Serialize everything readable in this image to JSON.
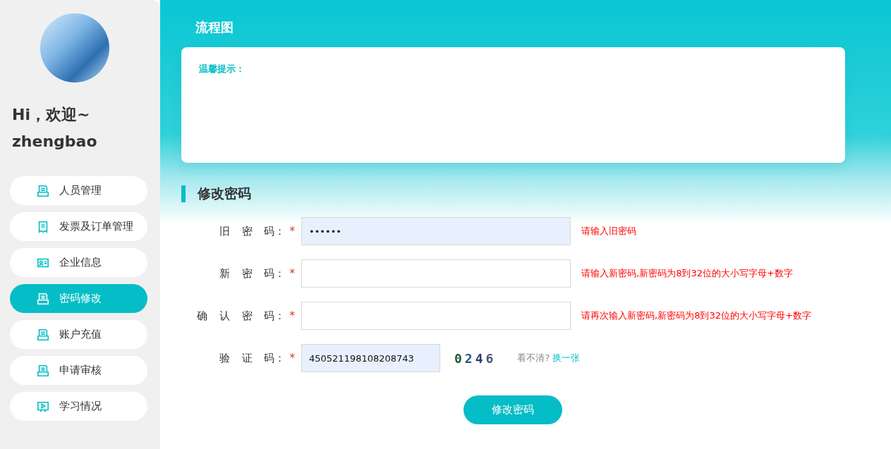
{
  "sidebar": {
    "greeting": "Hi，欢迎~",
    "username": "zhengbao",
    "items": [
      {
        "label": "人员管理",
        "selected": false
      },
      {
        "label": "发票及订单管理",
        "selected": false
      },
      {
        "label": "企业信息",
        "selected": false
      },
      {
        "label": "密码修改",
        "selected": true
      },
      {
        "label": "账户充值",
        "selected": false
      },
      {
        "label": "申请审核",
        "selected": false
      },
      {
        "label": "学习情况",
        "selected": false
      }
    ]
  },
  "page_title": "流程图",
  "notice": {
    "title": "温馨提示："
  },
  "section_title": "修改密码",
  "form": {
    "fields": [
      {
        "label": "旧 密 码：",
        "required_mark": "*",
        "value": "••••••",
        "hint": "请输入旧密码",
        "filled": true
      },
      {
        "label": "新 密 码：",
        "required_mark": "*",
        "hint": "请输入新密码,新密码为8到32位的大小写字母+数字",
        "filled": false
      },
      {
        "label": "确 认 密 码：",
        "required_mark": "*",
        "hint": "请再次输入新密码,新密码为8到32位的大小写字母+数字",
        "filled": false
      }
    ],
    "captcha": {
      "label": "验 证 码：",
      "required_mark": "*",
      "value": "450521198108208743",
      "code": "0246",
      "unclear": "看不清?",
      "refresh": "换一张"
    },
    "submit": "修改密码"
  }
}
